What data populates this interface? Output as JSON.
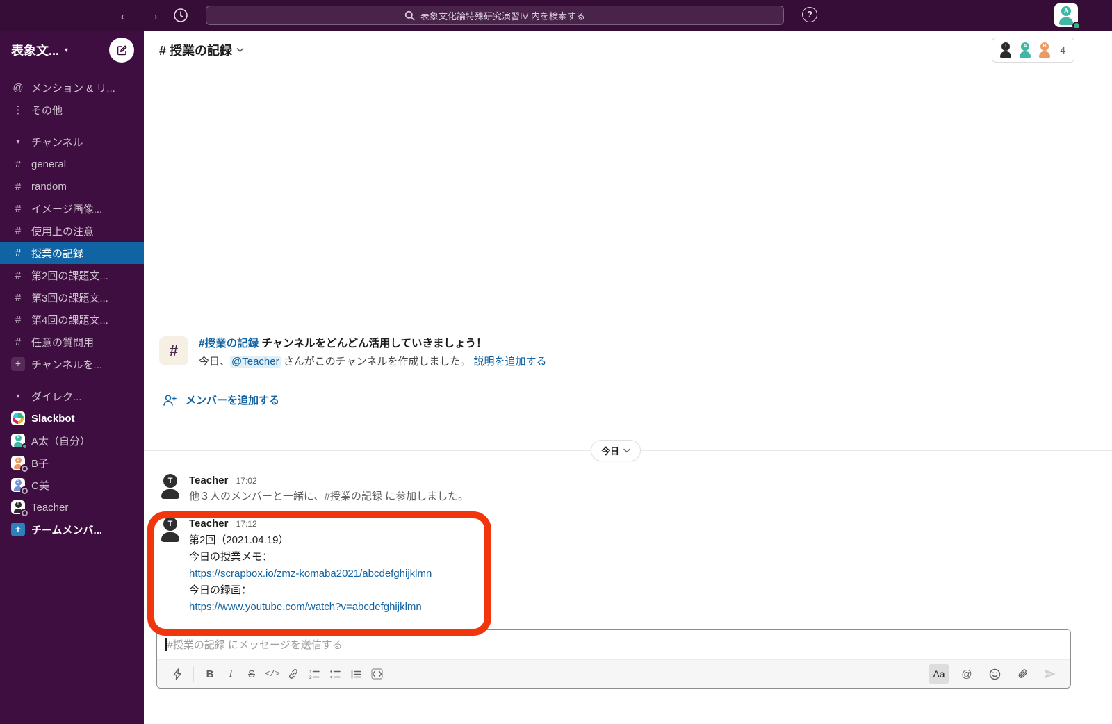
{
  "icons": {
    "at": "@",
    "dots": "⋮",
    "chevron_down_small": "▾",
    "hash": "#",
    "plus": "+"
  },
  "topbar": {
    "search_text": "表象文化論特殊研究演習IV 内を検索する",
    "help": "?",
    "avatar_letter": "A"
  },
  "sidebar": {
    "workspace_name": "表象文...",
    "nav_items": [
      {
        "icon": "at",
        "label": "メンション & リ..."
      },
      {
        "icon": "dots",
        "label": "その他"
      }
    ],
    "channels_header": "チャンネル",
    "channels": [
      {
        "label": "general",
        "selected": false
      },
      {
        "label": "random",
        "selected": false
      },
      {
        "label": "イメージ画像...",
        "selected": false
      },
      {
        "label": "使用上の注意",
        "selected": false
      },
      {
        "label": "授業の記録",
        "selected": true
      },
      {
        "label": "第2回の課題文...",
        "selected": false
      },
      {
        "label": "第3回の課題文...",
        "selected": false
      },
      {
        "label": "第4回の課題文...",
        "selected": false
      },
      {
        "label": "任意の質問用",
        "selected": false
      }
    ],
    "add_channel_label": "チャンネルを...",
    "dm_header": "ダイレク...",
    "dms": [
      {
        "label": "Slackbot",
        "bold": true,
        "avatar": "slackbot",
        "letter": "",
        "color": "",
        "presence": "none"
      },
      {
        "label": "A太（自分）",
        "bold": false,
        "avatar": "person",
        "letter": "A",
        "color": "#3FB7A4",
        "presence": "online"
      },
      {
        "label": "B子",
        "bold": false,
        "avatar": "person",
        "letter": "B",
        "color": "#EC9A62",
        "presence": "offline"
      },
      {
        "label": "C美",
        "bold": false,
        "avatar": "person",
        "letter": "C",
        "color": "#7191D6",
        "presence": "offline"
      },
      {
        "label": "Teacher",
        "bold": false,
        "avatar": "person",
        "letter": "T",
        "color": "#2B2B2B",
        "presence": "offline"
      }
    ],
    "add_member_label": "チームメンバ..."
  },
  "header": {
    "channel_name": "# 授業の記録",
    "members": [
      {
        "letter": "T",
        "color": "#2B2B2B"
      },
      {
        "letter": "A",
        "color": "#3FB7A4"
      },
      {
        "letter": "B",
        "color": "#EC9A62"
      }
    ],
    "member_count": "4"
  },
  "intro": {
    "channel_link": "#授業の記録",
    "title_rest": " チャンネルをどんどん活用していきましょう！",
    "line2_pre": "今日、",
    "mention": "@Teacher",
    "line2_mid": " さんがこのチャンネルを作成しました。 ",
    "add_description_link": "説明を追加する",
    "add_member_label": "メンバーを追加する"
  },
  "date_divider": "今日",
  "messages": [
    {
      "author": "Teacher",
      "avatar_letter": "T",
      "time": "17:02",
      "text_pre": "他３人のメンバーと一緒に、",
      "text_link": "#授業の記録",
      "text_post": " に参加しました。"
    },
    {
      "author": "Teacher",
      "avatar_letter": "T",
      "time": "17:12",
      "lines": [
        {
          "type": "text",
          "value": "第2回（2021.04.19）"
        },
        {
          "type": "text",
          "value": "今日の授業メモ："
        },
        {
          "type": "link",
          "value": "https://scrapbox.io/zmz-komaba2021/abcdefghijklmn"
        },
        {
          "type": "text",
          "value": "今日の録画："
        },
        {
          "type": "link",
          "value": "https://www.youtube.com/watch?v=abcdefghijklmn"
        }
      ]
    }
  ],
  "composer": {
    "placeholder": "#授業の記録 にメッセージを送信する",
    "format_button": "Aa",
    "at_button": "@"
  },
  "colors": {
    "sidebar_bg": "#3F0E40",
    "topbar_bg": "#350D36",
    "selected_blue": "#1164A3",
    "link_blue": "#1264A3",
    "annotation_red": "#F1360E",
    "presence_green": "#2EB67D"
  }
}
